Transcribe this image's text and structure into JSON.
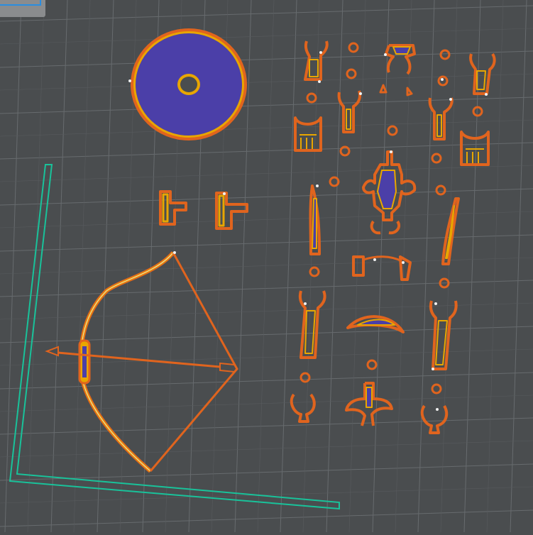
{
  "app": {
    "view": "3d-slicer-layer-preview"
  },
  "colors": {
    "background": "#4a4d4f",
    "grid": "#6b6f72",
    "outer_wall": "#e0641e",
    "inner_wall": "#e8a600",
    "infill": "#4b3fa8",
    "travel_white": "#f0f0f0",
    "skirt": "#19c29a",
    "selection": "#2a8de0"
  },
  "parts": [
    {
      "name": "shield"
    },
    {
      "name": "bow"
    },
    {
      "name": "arrow"
    },
    {
      "name": "skirt-outline"
    }
  ]
}
